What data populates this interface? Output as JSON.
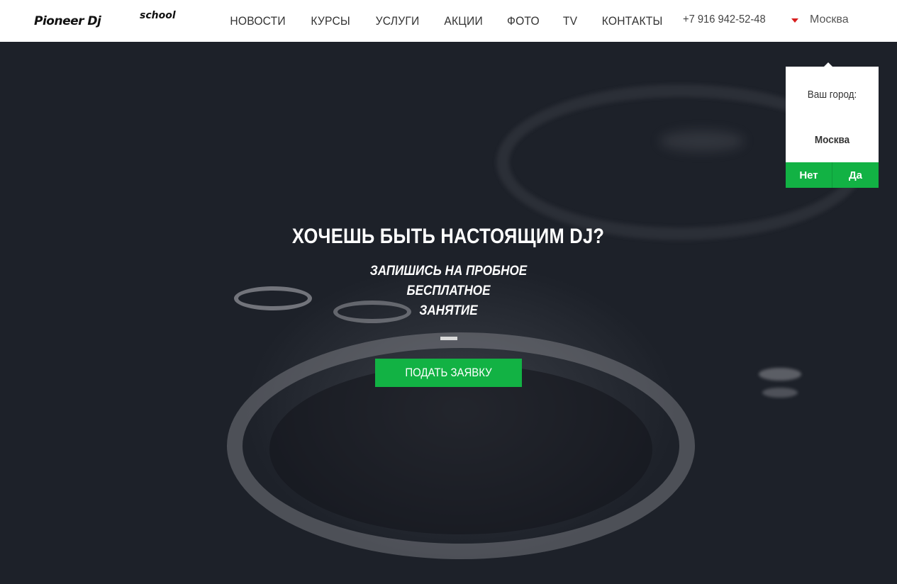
{
  "header": {
    "logo_brand": "Pioneer Dj",
    "logo_sub": "school",
    "nav": [
      "НОВОСТИ",
      "КУРСЫ",
      "УСЛУГИ",
      "АКЦИИ",
      "ФОТО",
      "TV",
      "КОНТАКТЫ"
    ],
    "phone": "+7 916 942-52-48",
    "city": "Москва"
  },
  "city_popup": {
    "label": "Ваш город:",
    "city": "Москва",
    "no": "Нет",
    "yes": "Да"
  },
  "hero": {
    "title": "ХОЧЕШЬ БЫТЬ НАСТОЯЩИМ DJ?",
    "subtitle_lines": [
      "ЗАПИШИСЬ НА ПРОБНОЕ",
      "БЕСПЛАТНОЕ",
      "ЗАНЯТИЕ"
    ],
    "cta": "ПОДАТЬ ЗАЯВКУ"
  },
  "colors": {
    "accent": "#12b244",
    "caret": "#d81e1e",
    "hero_bg": "#1c2027"
  }
}
